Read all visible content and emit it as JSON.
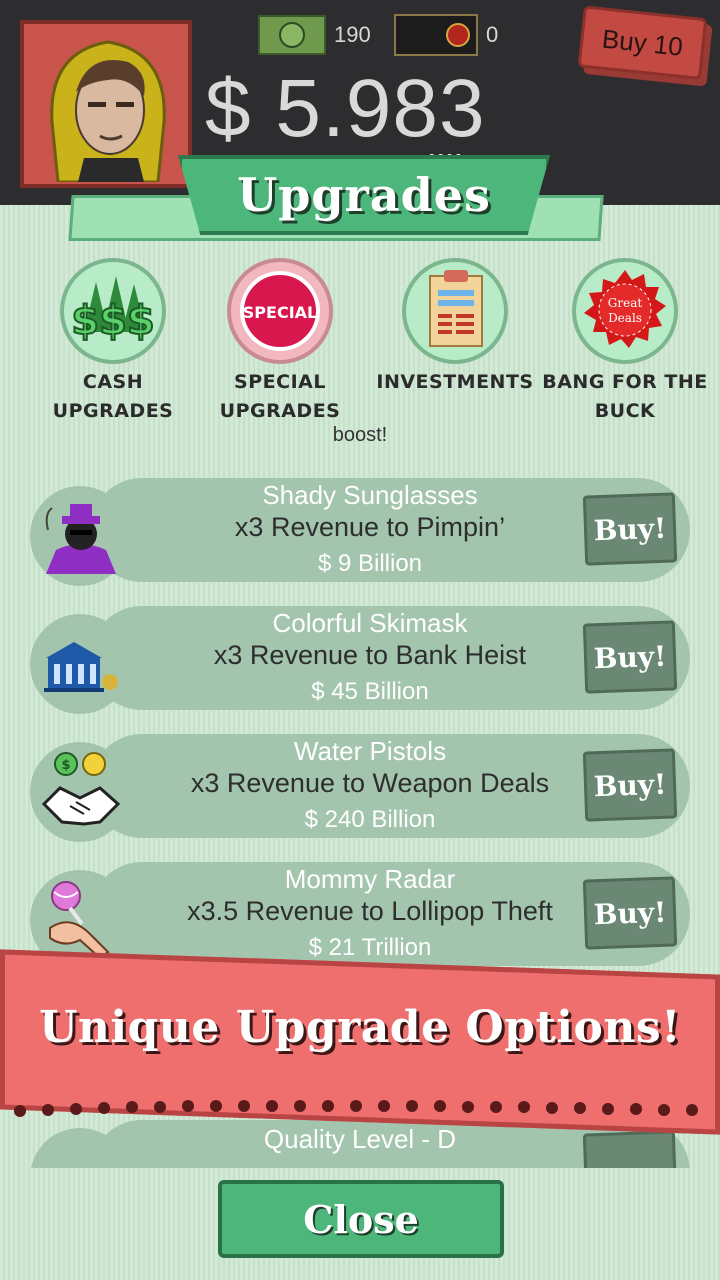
{
  "header": {
    "cash_bills_count": "190",
    "gold_bills_count": "0",
    "money": "$ 5.983",
    "money_unit": "Unquattuortrillion",
    "buy_multiplier": "Buy 10"
  },
  "panel": {
    "title": "Upgrades",
    "categories": [
      {
        "label_line1": "Cash",
        "label_line2": "Upgrades",
        "icon": "cash-trees-icon"
      },
      {
        "label_line1": "Special",
        "label_line2": "Upgrades",
        "icon": "special-badge-icon"
      },
      {
        "label_line1": "Investments",
        "label_line2": "",
        "icon": "clipboard-icon"
      },
      {
        "label_line1": "Bang for the",
        "label_line2": "buck",
        "icon": "great-deals-icon"
      }
    ],
    "special_badge_text": "SPECIAL",
    "great_deals_text_1": "Great",
    "great_deals_text_2": "Deals",
    "boost_text": "boost!",
    "upgrades": [
      {
        "name": "Shady Sunglasses",
        "desc": "x3 Revenue to Pimpin’",
        "price": "$ 9 Billion",
        "buy": "Buy!",
        "icon": "pimp-icon"
      },
      {
        "name": "Colorful Skimask",
        "desc": "x3 Revenue to Bank Heist",
        "price": "$ 45 Billion",
        "buy": "Buy!",
        "icon": "bank-icon"
      },
      {
        "name": "Water Pistols",
        "desc": "x3 Revenue to Weapon Deals",
        "price": "$ 240 Billion",
        "buy": "Buy!",
        "icon": "handshake-icon"
      },
      {
        "name": "Mommy Radar",
        "desc": "x3.5 Revenue to Lollipop Theft",
        "price": "$ 21 Trillion",
        "buy": "Buy!",
        "icon": "lollipop-icon"
      }
    ],
    "partial_item": "Quality Level - D",
    "promo_text": "Unique Upgrade Options!",
    "close_label": "Close"
  }
}
